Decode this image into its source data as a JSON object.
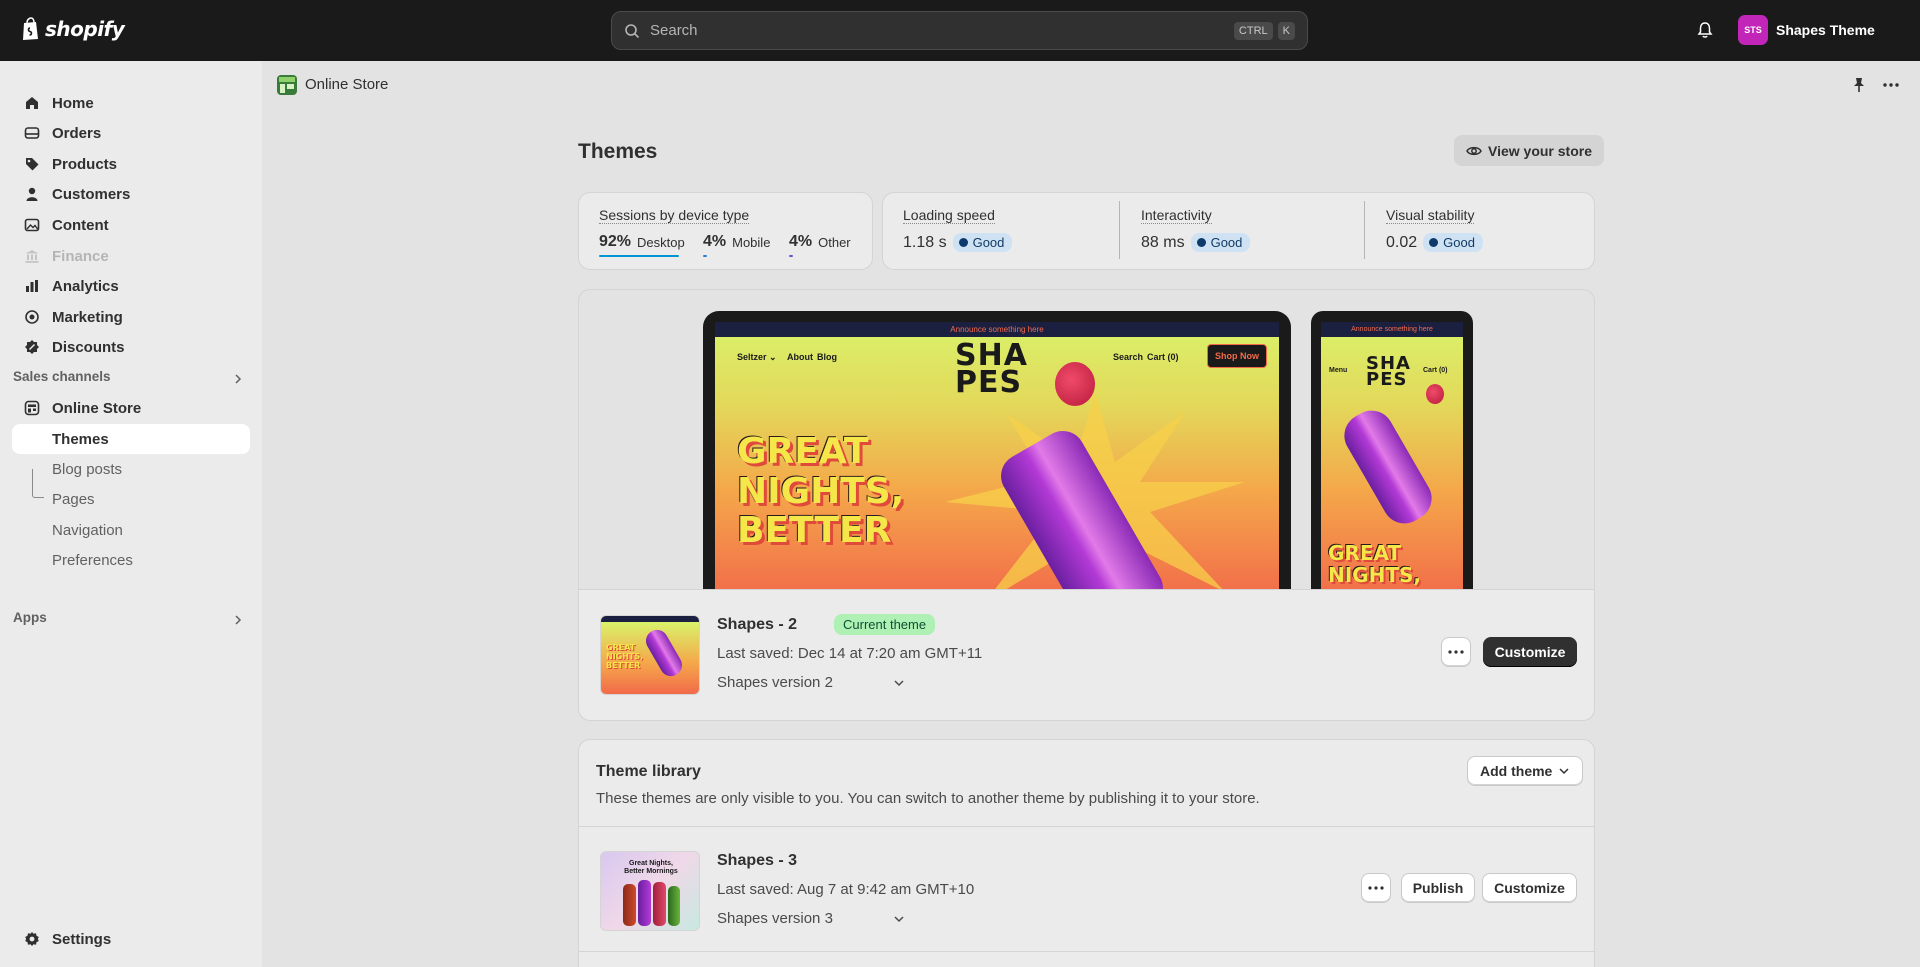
{
  "topbar": {
    "brand": "shopify",
    "search_placeholder": "Search",
    "shortcut_keys": [
      "CTRL",
      "K"
    ],
    "avatar_initials": "STS",
    "store_name": "Shapes Theme"
  },
  "sidebar": {
    "items": [
      {
        "label": "Home",
        "icon": "home-icon"
      },
      {
        "label": "Orders",
        "icon": "orders-icon"
      },
      {
        "label": "Products",
        "icon": "tag-icon"
      },
      {
        "label": "Customers",
        "icon": "person-icon"
      },
      {
        "label": "Content",
        "icon": "content-icon"
      },
      {
        "label": "Finance",
        "icon": "bank-icon",
        "disabled": true
      },
      {
        "label": "Analytics",
        "icon": "bar-chart-icon"
      },
      {
        "label": "Marketing",
        "icon": "target-icon"
      },
      {
        "label": "Discounts",
        "icon": "discount-icon"
      }
    ],
    "sales_channels_title": "Sales channels",
    "online_store_label": "Online Store",
    "sub_items": [
      "Themes",
      "Blog posts",
      "Pages",
      "Navigation",
      "Preferences"
    ],
    "apps_title": "Apps",
    "settings_label": "Settings"
  },
  "header": {
    "title": "Online Store"
  },
  "page": {
    "title": "Themes",
    "view_store": "View your store"
  },
  "metrics": {
    "sessions_label": "Sessions by device type",
    "devices": [
      {
        "pct": "92%",
        "name": "Desktop",
        "color": "#0094d5"
      },
      {
        "pct": "4%",
        "name": "Mobile",
        "color": "#2a7fd4"
      },
      {
        "pct": "4%",
        "name": "Other",
        "color": "#5a5ad6"
      }
    ],
    "loading": {
      "label": "Loading speed",
      "value": "1.18 s",
      "status": "Good"
    },
    "interactivity": {
      "label": "Interactivity",
      "value": "88 ms",
      "status": "Good"
    },
    "stability": {
      "label": "Visual stability",
      "value": "0.02",
      "status": "Good"
    }
  },
  "preview": {
    "announce": "Announce something here",
    "nav_left": [
      "Seltzer ⌄",
      "About",
      "Blog"
    ],
    "nav_right": [
      "Search",
      "Cart (0)"
    ],
    "shop_now": "Shop Now",
    "brand_line1": "SHA",
    "brand_line2": "PES",
    "hero_lines": [
      "GREAT",
      "NIGHTS,",
      "BETTER"
    ],
    "phone_menu": "Menu",
    "phone_cart": "Cart (0)",
    "phone_hero": [
      "GREAT",
      "NIGHTS,"
    ]
  },
  "current_theme": {
    "name": "Shapes - 2",
    "badge": "Current theme",
    "saved": "Last saved: Dec 14 at 7:20 am GMT+11",
    "version": "Shapes version 2",
    "customize": "Customize"
  },
  "library": {
    "title": "Theme library",
    "description": "These themes are only visible to you. You can switch to another theme by publishing it to your store.",
    "add_theme": "Add theme",
    "theme": {
      "name": "Shapes - 3",
      "saved": "Last saved: Aug 7 at 9:42 am GMT+10",
      "version": "Shapes version 3",
      "publish": "Publish",
      "customize": "Customize",
      "thumb_text": "Great Nights, Better Mornings"
    }
  }
}
